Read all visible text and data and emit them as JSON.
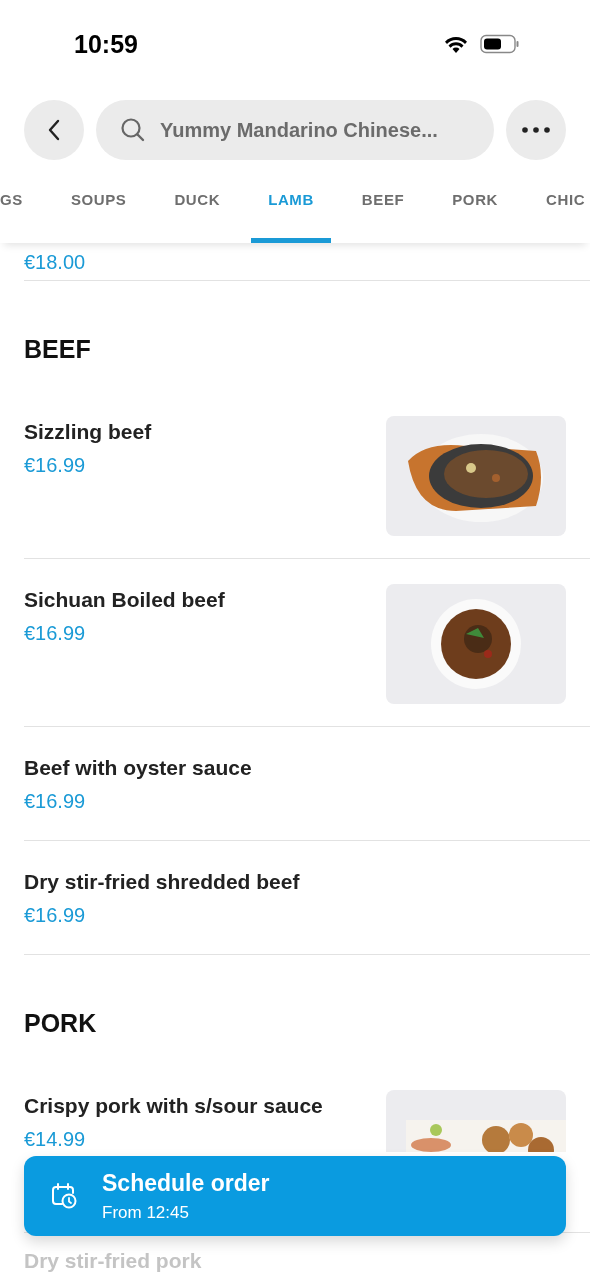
{
  "status_bar": {
    "time": "10:59"
  },
  "header": {
    "title": "Yummy Mandarino Chinese..."
  },
  "tabs": [
    {
      "label": "GS",
      "selected": false
    },
    {
      "label": "SOUPS",
      "selected": false
    },
    {
      "label": "DUCK",
      "selected": false
    },
    {
      "label": "LAMB",
      "selected": true
    },
    {
      "label": "BEEF",
      "selected": false
    },
    {
      "label": "PORK",
      "selected": false
    },
    {
      "label": "CHIC",
      "selected": false
    }
  ],
  "partial_item": {
    "price": "€18.00"
  },
  "sections": [
    {
      "title": "BEEF",
      "items": [
        {
          "name": "Sizzling beef",
          "price": "€16.99"
        },
        {
          "name": "Sichuan Boiled beef",
          "price": "€16.99"
        },
        {
          "name": "Beef with oyster sauce",
          "price": "€16.99"
        },
        {
          "name": "Dry stir-fried shredded beef",
          "price": "€16.99"
        }
      ]
    },
    {
      "title": "PORK",
      "items": [
        {
          "name": "Crispy pork with s/sour sauce",
          "price": "€14.99"
        },
        {
          "name": "Dry stir-fried pork"
        }
      ]
    }
  ],
  "schedule_button": {
    "title": "Schedule order",
    "subtitle": "From 12:45"
  }
}
